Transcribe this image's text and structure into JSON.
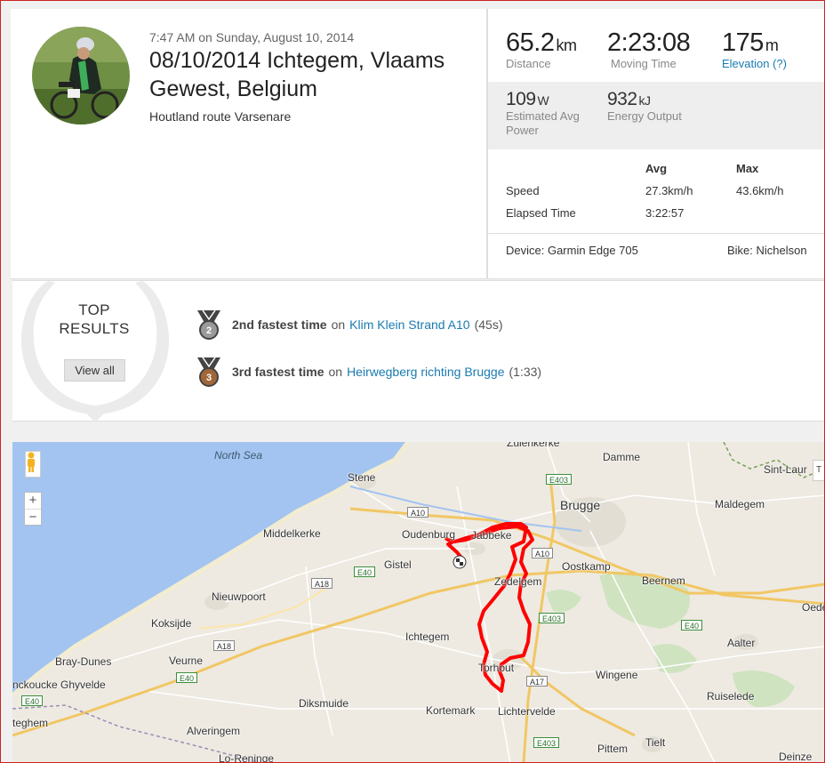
{
  "activity": {
    "datetime": "7:47 AM on Sunday, August 10, 2014",
    "title": "08/10/2014 Ichtegem, Vlaams Gewest, Belgium",
    "description": "Houtland route Varsenare"
  },
  "stats": {
    "distance": {
      "value": "65.2",
      "unit": "km",
      "label": "Distance"
    },
    "moving_time": {
      "value": "2:23:08",
      "label": "Moving Time"
    },
    "elevation": {
      "value": "175",
      "unit": "m",
      "label": "Elevation (?)"
    },
    "power": {
      "value": "109",
      "unit": "W",
      "label": "Estimated Avg Power"
    },
    "energy": {
      "value": "932",
      "unit": "kJ",
      "label": "Energy Output"
    }
  },
  "details": {
    "col_avg": "Avg",
    "col_max": "Max",
    "rows": [
      {
        "label": "Speed",
        "avg": "27.3km/h",
        "max": "43.6km/h"
      },
      {
        "label": "Elapsed Time",
        "avg": "3:22:57",
        "max": ""
      }
    ],
    "device": "Device: Garmin Edge 705",
    "bike": "Bike: Nichelson"
  },
  "top_results": {
    "heading_line1": "TOP",
    "heading_line2": "RESULTS",
    "view_all": "View all",
    "items": [
      {
        "rank": "2",
        "achievement": "2nd fastest time",
        "on": "on",
        "segment": "Klim Klein Strand A10",
        "time": "(45s)",
        "medal_color": "#9a9a9a"
      },
      {
        "rank": "3",
        "achievement": "3rd fastest time",
        "on": "on",
        "segment": "Heirwegberg richting Brugge",
        "time": "(1:33)",
        "medal_color": "#a0673a"
      }
    ]
  },
  "map": {
    "zoom_in": "+",
    "zoom_out": "−",
    "places": {
      "north_sea": "North Sea",
      "stene": "Stene",
      "middelkerke": "Middelkerke",
      "oudenburg": "Oudenburg",
      "jabbeke": "Jabbeke",
      "gistel": "Gistel",
      "bruges": "Brugge",
      "damme": "Damme",
      "zuienkerke": "Zuienkerke",
      "maldegem": "Maldegem",
      "sint_laureins": "Sint-Laur",
      "oostkamp": "Oostkamp",
      "beernem": "Beernem",
      "zedelgem": "Zedelgem",
      "nieuwpoort": "Nieuwpoort",
      "koksijde": "Koksijde",
      "ichtegem": "Ichtegem",
      "torhout": "Torhout",
      "aalter": "Aalter",
      "bray_dunes": "Bray-Dunes",
      "veurne": "Veurne",
      "zuydcoote": "nckoucke Ghyvelde",
      "wingene": "Wingene",
      "ruiselede": "Ruiselede",
      "diksmuide": "Diksmuide",
      "kortemark": "Kortemark",
      "lichtervelde": "Lichtervelde",
      "alveringem": "Alveringem",
      "pittem": "Pittem",
      "tielt": "Tielt",
      "teghem": "teghem",
      "lo_reninge": "Lo-Reninge",
      "oedenburg": "Oeden",
      "deinze": "Deinze"
    },
    "roads": {
      "a10a": "A10",
      "a10b": "A10",
      "a18a": "A18",
      "a18b": "A18",
      "e40a": "E40",
      "e40b": "E40",
      "e40c": "E40",
      "e40d": "E40",
      "e403a": "E403",
      "e403b": "E403",
      "e403c": "E403",
      "a17": "A17"
    },
    "route_color": "#ff0000"
  }
}
